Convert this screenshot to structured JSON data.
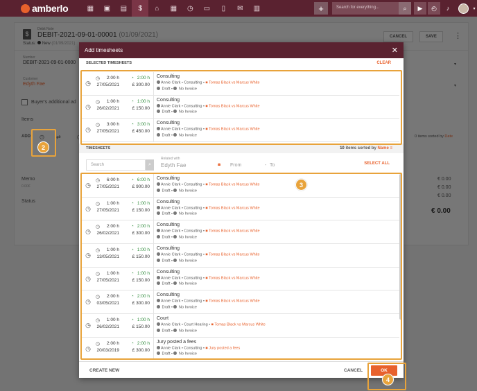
{
  "app": {
    "logo_text": "amberlo",
    "search_placeholder": "Search for everything...",
    "plus_label": "+"
  },
  "document": {
    "type_label": "Debit Note",
    "number": "DEBIT-2021-09-01-00001",
    "date": "(01/09/2021)",
    "status_label": "Status:",
    "status_value": "New",
    "status_date": "(01/09/2021)",
    "cancel_label": "CANCEL",
    "save_label": "SAVE",
    "number_label": "Number",
    "number_value": "DEBIT-2021-09-01-0000",
    "customer_label": "Customer",
    "customer_value": "Edyth Fae",
    "buyer_checkbox_label": "Buyer's additional ad",
    "items_label": "Items",
    "add_label": "ADD",
    "memo_label": "Memo",
    "memo_value": "0.00€",
    "status_field_label": "Status",
    "sort_text": "0 items sorted by",
    "sort_field": "Date",
    "totals": [
      "€ 0.00",
      "€ 0.00",
      "€ 0.00"
    ],
    "grand_total": "€ 0.00"
  },
  "modal": {
    "title": "Add timesheets",
    "close_icon": "close-icon",
    "selected_header": "SELECTED TIMESHEETS",
    "clear_label": "CLEAR",
    "timesheets_header": "TIMESHEETS",
    "sort_count": "10",
    "sort_text": "items sorted by",
    "sort_field": "Name",
    "search_placeholder": "Search",
    "related_label": "Related with",
    "related_value": "Edyth Fae",
    "from_placeholder": "From",
    "dash": "-",
    "to_placeholder": "To",
    "select_all_label": "SELECT ALL",
    "create_new_label": "CREATE NEW",
    "cancel_label": "CANCEL",
    "ok_label": "OK"
  },
  "selected_timesheets": [
    {
      "duration": "2:00 h",
      "date": "27/05/2021",
      "billable": "2:00 h",
      "amount": "£ 300.00",
      "title": "Consulting",
      "user": "Annie Clark",
      "activity": "Consulting",
      "matter": "Tomas Black vs Marcus White",
      "state": "Draft",
      "invoice": "No Invoice"
    },
    {
      "duration": "1:00 h",
      "date": "26/02/2021",
      "billable": "1:00 h",
      "amount": "£ 150.00",
      "title": "Consulting",
      "user": "Annie Clark",
      "activity": "Consulting",
      "matter": "Tomas Black vs Marcus White",
      "state": "Draft",
      "invoice": "No Invoice"
    },
    {
      "duration": "3:00 h",
      "date": "27/05/2021",
      "billable": "3:00 h",
      "amount": "£ 450.00",
      "title": "Consulting",
      "user": "Annie Clark",
      "activity": "Consulting",
      "matter": "Tomas Black vs Marcus White",
      "state": "Draft",
      "invoice": "No Invoice"
    }
  ],
  "timesheets": [
    {
      "duration": "6:00 h",
      "date": "27/05/2021",
      "billable": "6:00 h",
      "amount": "£ 900.00",
      "title": "Consulting",
      "user": "Annie Clark",
      "activity": "Consulting",
      "matter": "Tomas Black vs Marcus White",
      "state": "Draft",
      "invoice": "No Invoice"
    },
    {
      "duration": "1:00 h",
      "date": "27/05/2021",
      "billable": "1:00 h",
      "amount": "£ 150.00",
      "title": "Consulting",
      "user": "Annie Clark",
      "activity": "Consulting",
      "matter": "Tomas Black vs Marcus White",
      "state": "Draft",
      "invoice": "No Invoice"
    },
    {
      "duration": "2:00 h",
      "date": "26/02/2021",
      "billable": "2:00 h",
      "amount": "£ 300.00",
      "title": "Consulting",
      "user": "Annie Clark",
      "activity": "Consulting",
      "matter": "Tomas Black vs Marcus White",
      "state": "Draft",
      "invoice": "No Invoice"
    },
    {
      "duration": "1:00 h",
      "date": "13/05/2021",
      "billable": "1:00 h",
      "amount": "£ 150.00",
      "title": "Consulting",
      "user": "Annie Clark",
      "activity": "Consulting",
      "matter": "Tomas Black vs Marcus White",
      "state": "Draft",
      "invoice": "No Invoice"
    },
    {
      "duration": "1:00 h",
      "date": "27/05/2021",
      "billable": "1:00 h",
      "amount": "£ 150.00",
      "title": "Consulting",
      "user": "Annie Clark",
      "activity": "Consulting",
      "matter": "Tomas Black vs Marcus White",
      "state": "Draft",
      "invoice": "No Invoice"
    },
    {
      "duration": "2:00 h",
      "date": "03/05/2021",
      "billable": "2:00 h",
      "amount": "£ 300.00",
      "title": "Consulting",
      "user": "Annie Clark",
      "activity": "Consulting",
      "matter": "Tomas Black vs Marcus White",
      "state": "Draft",
      "invoice": "No Invoice"
    },
    {
      "duration": "1:00 h",
      "date": "26/02/2021",
      "billable": "1:00 h",
      "amount": "£ 150.00",
      "title": "Court",
      "user": "Annie Clark",
      "activity": "Court Hearing",
      "matter": "Tomas Black vs Marcus White",
      "state": "Draft",
      "invoice": "No Invoice"
    },
    {
      "duration": "2:00 h",
      "date": "20/03/2019",
      "billable": "2:00 h",
      "amount": "£ 300.00",
      "title": "Jury posted a fees",
      "user": "Annie Clark",
      "activity": "Consulting",
      "matter": "Jury posted a fees",
      "state": "Draft",
      "invoice": "No Invoice"
    }
  ],
  "annotations": [
    "2",
    "3",
    "4"
  ],
  "colors": {
    "brand": "#5a2230",
    "accent": "#e8612c",
    "highlight": "#e8a33b",
    "billable": "#2e8b3a"
  }
}
